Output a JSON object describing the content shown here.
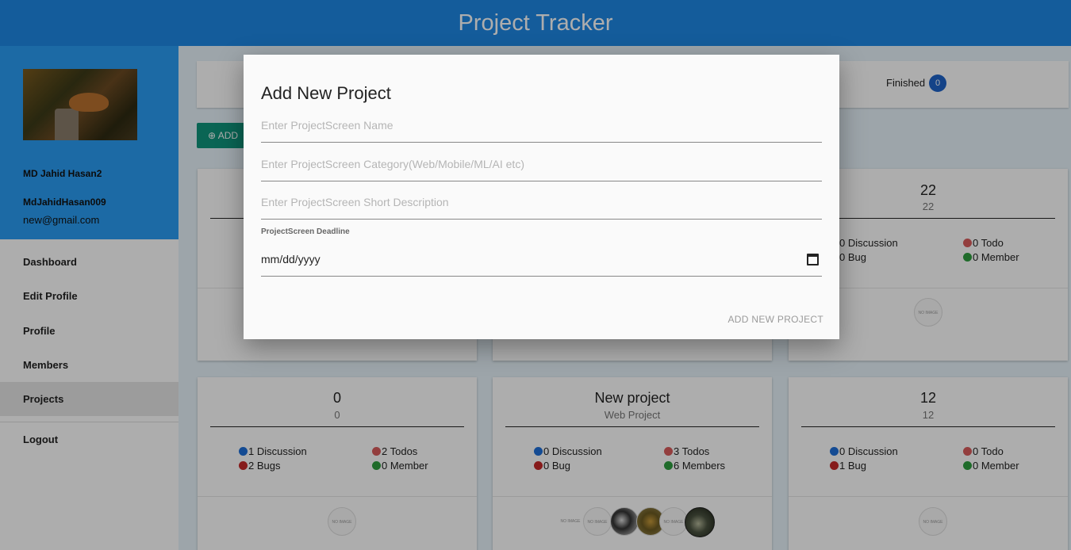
{
  "app": {
    "title": "Project Tracker"
  },
  "sidebar": {
    "user": {
      "name": "MD Jahid Hasan2",
      "handle": "MdJahidHasan009",
      "email": "new@gmail.com"
    },
    "items": [
      {
        "label": "Dashboard"
      },
      {
        "label": "Edit Profile"
      },
      {
        "label": "Profile"
      },
      {
        "label": "Members"
      },
      {
        "label": "Projects",
        "active": true
      },
      {
        "label": "Logout"
      }
    ]
  },
  "status": {
    "finished_label": "Finished",
    "finished_count": "0"
  },
  "toolbar": {
    "add_label": "ADD"
  },
  "cards": [
    {
      "title": "22",
      "subtitle": "22",
      "discussion": "0 Discussion",
      "todo": "0 Todo",
      "bug": "0 Bug",
      "member": "0 Member"
    },
    {
      "title": "0",
      "subtitle": "0",
      "discussion": "1 Discussion",
      "todo": "2 Todos",
      "bug": "2 Bugs",
      "member": "0 Member"
    },
    {
      "title": "New project",
      "subtitle": "Web Project",
      "discussion": "0 Discussion",
      "todo": "3 Todos",
      "bug": "0 Bug",
      "member": "6 Members"
    },
    {
      "title": "12",
      "subtitle": "12",
      "discussion": "0 Discussion",
      "todo": "0 Todo",
      "bug": "1 Bug",
      "member": "0 Member"
    }
  ],
  "modal": {
    "title": "Add New Project",
    "name_placeholder": "Enter ProjectScreen Name",
    "category_placeholder": "Enter ProjectScreen Category(Web/Mobile/ML/AI etc)",
    "description_placeholder": "Enter ProjectScreen Short Description",
    "deadline_label": "ProjectScreen Deadline",
    "deadline_value": "mm/dd/yyyy",
    "submit_label": "ADD NEW PROJECT"
  },
  "colors": {
    "header": "#1e88e5",
    "sidebar_header": "#2a9df4",
    "add_button": "#10957d",
    "badge": "#1e63c9"
  },
  "icons": {
    "add": "plus-circle-icon",
    "calendar": "calendar-icon",
    "discussion": "blue-dot",
    "bug": "red-dot",
    "todo": "pink-dot",
    "member": "green-dot"
  }
}
